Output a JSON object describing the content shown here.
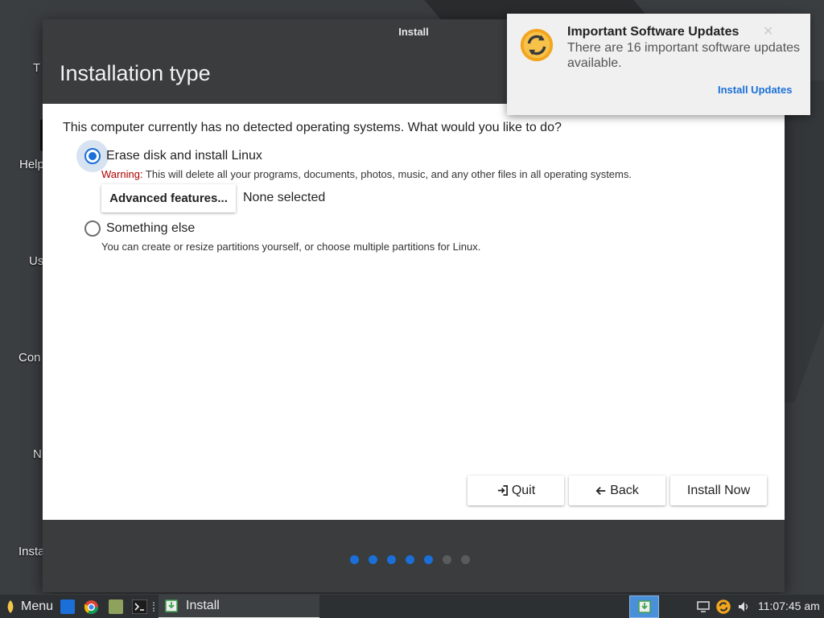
{
  "desktop": {
    "icons": [
      {
        "label": "T",
        "color": "#6a6a6a"
      },
      {
        "label": "Help",
        "color": "#111111"
      },
      {
        "label": "Us",
        "color": "#2aa7d6"
      },
      {
        "label": "Con",
        "color": "#2f7fd0"
      },
      {
        "label": "N",
        "color": "#8a3ea6"
      },
      {
        "label": "Insta",
        "color": "#3fa34d"
      }
    ]
  },
  "window": {
    "title": "Install",
    "heading": "Installation type",
    "question": "This computer currently has no detected operating systems. What would you like to do?",
    "option_erase": {
      "label": "Erase disk and install Linux",
      "selected": true,
      "warning_prefix": "Warning:",
      "warning_text": " This will delete all your programs, documents, photos, music, and any other files in all operating systems."
    },
    "advanced_button": "Advanced features...",
    "advanced_status": "None selected",
    "option_else": {
      "label": "Something else",
      "selected": false,
      "description": "You can create or resize partitions yourself, or choose multiple partitions for Linux."
    },
    "buttons": {
      "quit": "Quit",
      "back": "Back",
      "install": "Install Now"
    },
    "progress": {
      "total_steps": 7,
      "completed_steps": 5
    },
    "accent_color": "#1a6fd8"
  },
  "notification": {
    "title": "Important Software Updates",
    "body": "There are 16 important software updates available.",
    "action": "Install Updates",
    "close_glyph": "✕"
  },
  "taskbar": {
    "menu_label": "Menu",
    "window_label": "Install",
    "clock": "11:07:45 am",
    "launchers": [
      "files-icon",
      "browser-icon",
      "file-manager-icon",
      "terminal-icon"
    ]
  }
}
